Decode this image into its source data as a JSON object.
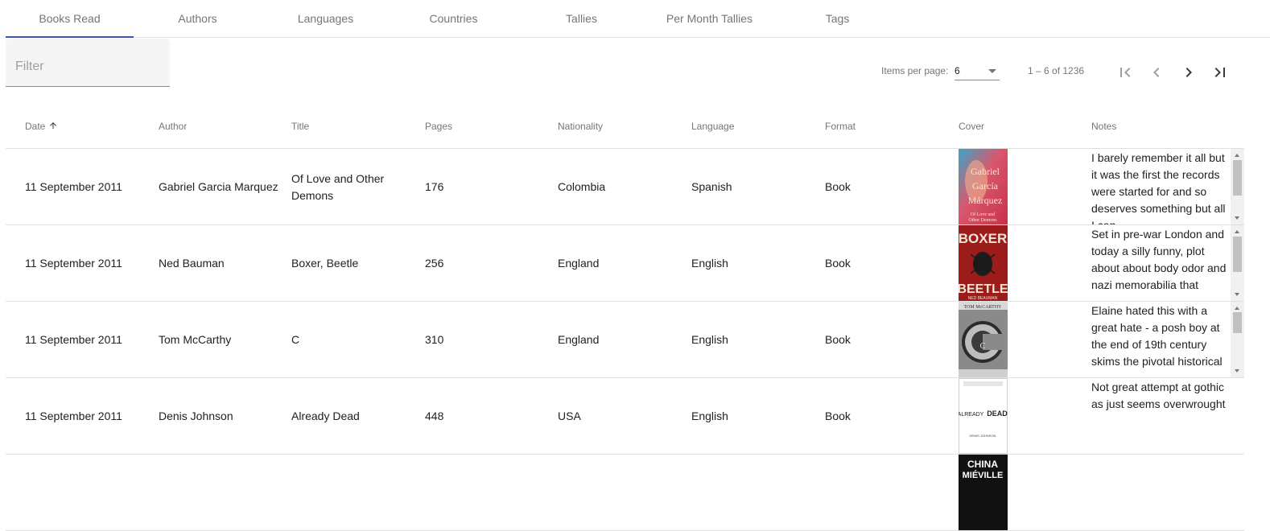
{
  "tabs": [
    {
      "label": "Books Read",
      "active": true
    },
    {
      "label": "Authors"
    },
    {
      "label": "Languages"
    },
    {
      "label": "Countries"
    },
    {
      "label": "Tallies"
    },
    {
      "label": "Per Month Tallies"
    },
    {
      "label": "Tags"
    }
  ],
  "filter": {
    "placeholder": "Filter",
    "value": ""
  },
  "paginator": {
    "items_per_page_label": "Items per page:",
    "items_per_page_value": "6",
    "range_label": "1 – 6 of 1236"
  },
  "table": {
    "headers": [
      "Date",
      "Author",
      "Title",
      "Pages",
      "Nationality",
      "Language",
      "Format",
      "Cover",
      "Notes"
    ],
    "sort": {
      "column": "Date",
      "direction": "ascending"
    },
    "rows": [
      {
        "date": "11 September 2011",
        "author": "Gabriel Garcia Marquez",
        "title": "Of Love and Other Demons",
        "pages": "176",
        "nationality": "Colombia",
        "language": "Spanish",
        "format": "Book",
        "cover": {
          "style": "warm",
          "lines": [
            "Gabriel",
            "García",
            "Márquez",
            "Of Love and",
            "Other Demons"
          ]
        },
        "notes": "I barely remember it all but it was the first the records were started for and so deserves something but all I can"
      },
      {
        "date": "11 September 2011",
        "author": "Ned Bauman",
        "title": "Boxer, Beetle",
        "pages": "256",
        "nationality": "England",
        "language": "English",
        "format": "Book",
        "cover": {
          "style": "red",
          "lines": [
            "BOXER",
            "BEETLE",
            "NED BEAUMAN"
          ]
        },
        "notes": "Set in pre-war London and today a silly funny, plot about about body odor and nazi memorabilia that"
      },
      {
        "date": "11 September 2011",
        "author": "Tom McCarthy",
        "title": "C",
        "pages": "310",
        "nationality": "England",
        "language": "English",
        "format": "Book",
        "cover": {
          "style": "grey",
          "lines": [
            "TOM McCARTHY",
            "C"
          ]
        },
        "notes": "Elaine hated this with a great hate - a posh boy at the end of 19th century skims the pivotal historical"
      },
      {
        "date": "11 September 2011",
        "author": "Denis Johnson",
        "title": "Already Dead",
        "pages": "448",
        "nationality": "USA",
        "language": "English",
        "format": "Book",
        "cover": {
          "style": "white",
          "lines": [
            "ALREADY",
            "DEAD",
            "DENIS JOHNSON"
          ]
        },
        "notes": "Not great attempt at gothic as just seems overwrought"
      },
      {
        "date": "",
        "author": "",
        "title": "",
        "pages": "",
        "nationality": "",
        "language": "",
        "format": "",
        "cover": {
          "style": "black",
          "lines": [
            "CHINA",
            "MIÉVILLE"
          ]
        },
        "notes": ""
      }
    ]
  },
  "colors": {
    "accent": "#3f51b5",
    "divider": "#e0e0e0",
    "muted_text": "#757575"
  }
}
